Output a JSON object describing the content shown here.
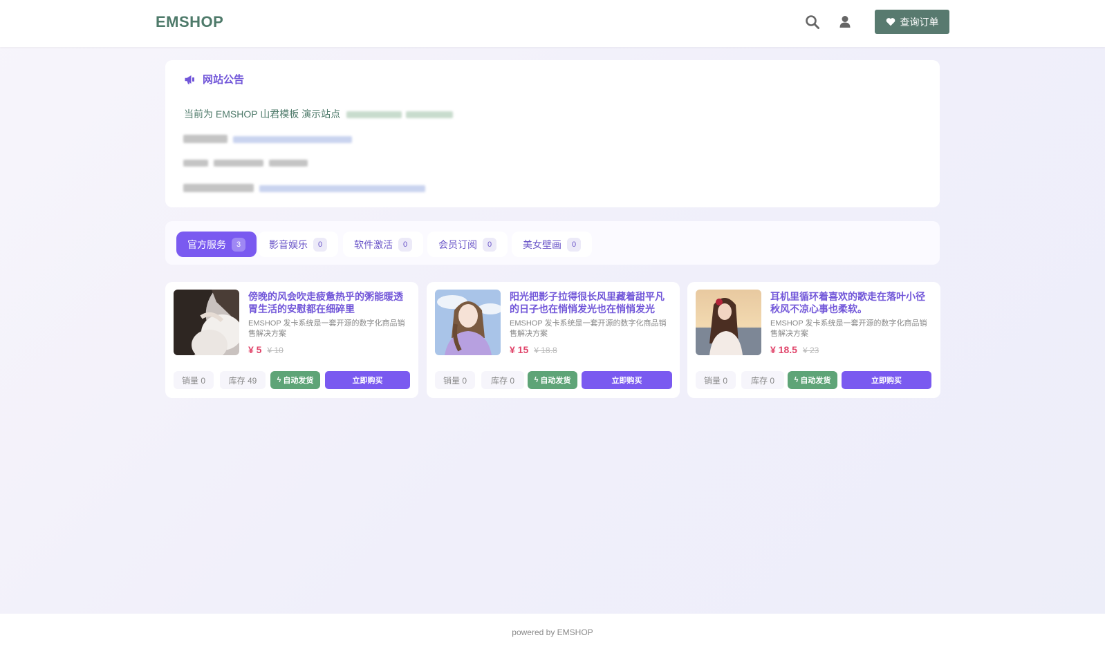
{
  "header": {
    "logo": "EMSHOP",
    "search_icon": "search-icon",
    "user_icon": "user-icon",
    "order_button": {
      "icon": "heart-icon",
      "label": "查询订单"
    }
  },
  "notice": {
    "icon": "megaphone-icon",
    "title": "网站公告",
    "line1": "当前为 EMSHOP 山君模板 演示站点"
  },
  "tabs": [
    {
      "label": "官方服务",
      "count": "3",
      "active": true
    },
    {
      "label": "影音娱乐",
      "count": "0",
      "active": false
    },
    {
      "label": "软件激活",
      "count": "0",
      "active": false
    },
    {
      "label": "会员订阅",
      "count": "0",
      "active": false
    },
    {
      "label": "美女壁画",
      "count": "0",
      "active": false
    }
  ],
  "products": [
    {
      "title": "傍晚的风会吹走疲惫热乎的粥能暖透胃生活的安慰都在细碎里",
      "desc": "EMSHOP 发卡系统是一套开源的数字化商品销售解决方案",
      "price": "¥ 5",
      "old_price": "¥ 10",
      "sales": "销量 0",
      "stock": "库存 49",
      "auto_label": "自动发货",
      "buy_label": "立即购买"
    },
    {
      "title": "阳光把影子拉得很长风里藏着甜平凡的日子也在悄悄发光也在悄悄发光",
      "desc": "EMSHOP 发卡系统是一套开源的数字化商品销售解决方案",
      "price": "¥ 15",
      "old_price": "¥ 18.8",
      "sales": "销量 0",
      "stock": "库存 0",
      "auto_label": "自动发货",
      "buy_label": "立即购买"
    },
    {
      "title": "耳机里循环着喜欢的歌走在落叶小径秋风不凉心事也柔软。",
      "desc": "EMSHOP 发卡系统是一套开源的数字化商品销售解决方案",
      "price": "¥ 18.5",
      "old_price": "¥ 23",
      "sales": "销量 0",
      "stock": "库存 0",
      "auto_label": "自动发货",
      "buy_label": "立即购买"
    }
  ],
  "footer": {
    "text": "powered by EMSHOP"
  },
  "colors": {
    "brand_green": "#4e7a6a",
    "order_button": "#587a6f",
    "accent_purple": "#7a5af0",
    "price_red": "#e0446a",
    "auto_green": "#5ea477"
  }
}
